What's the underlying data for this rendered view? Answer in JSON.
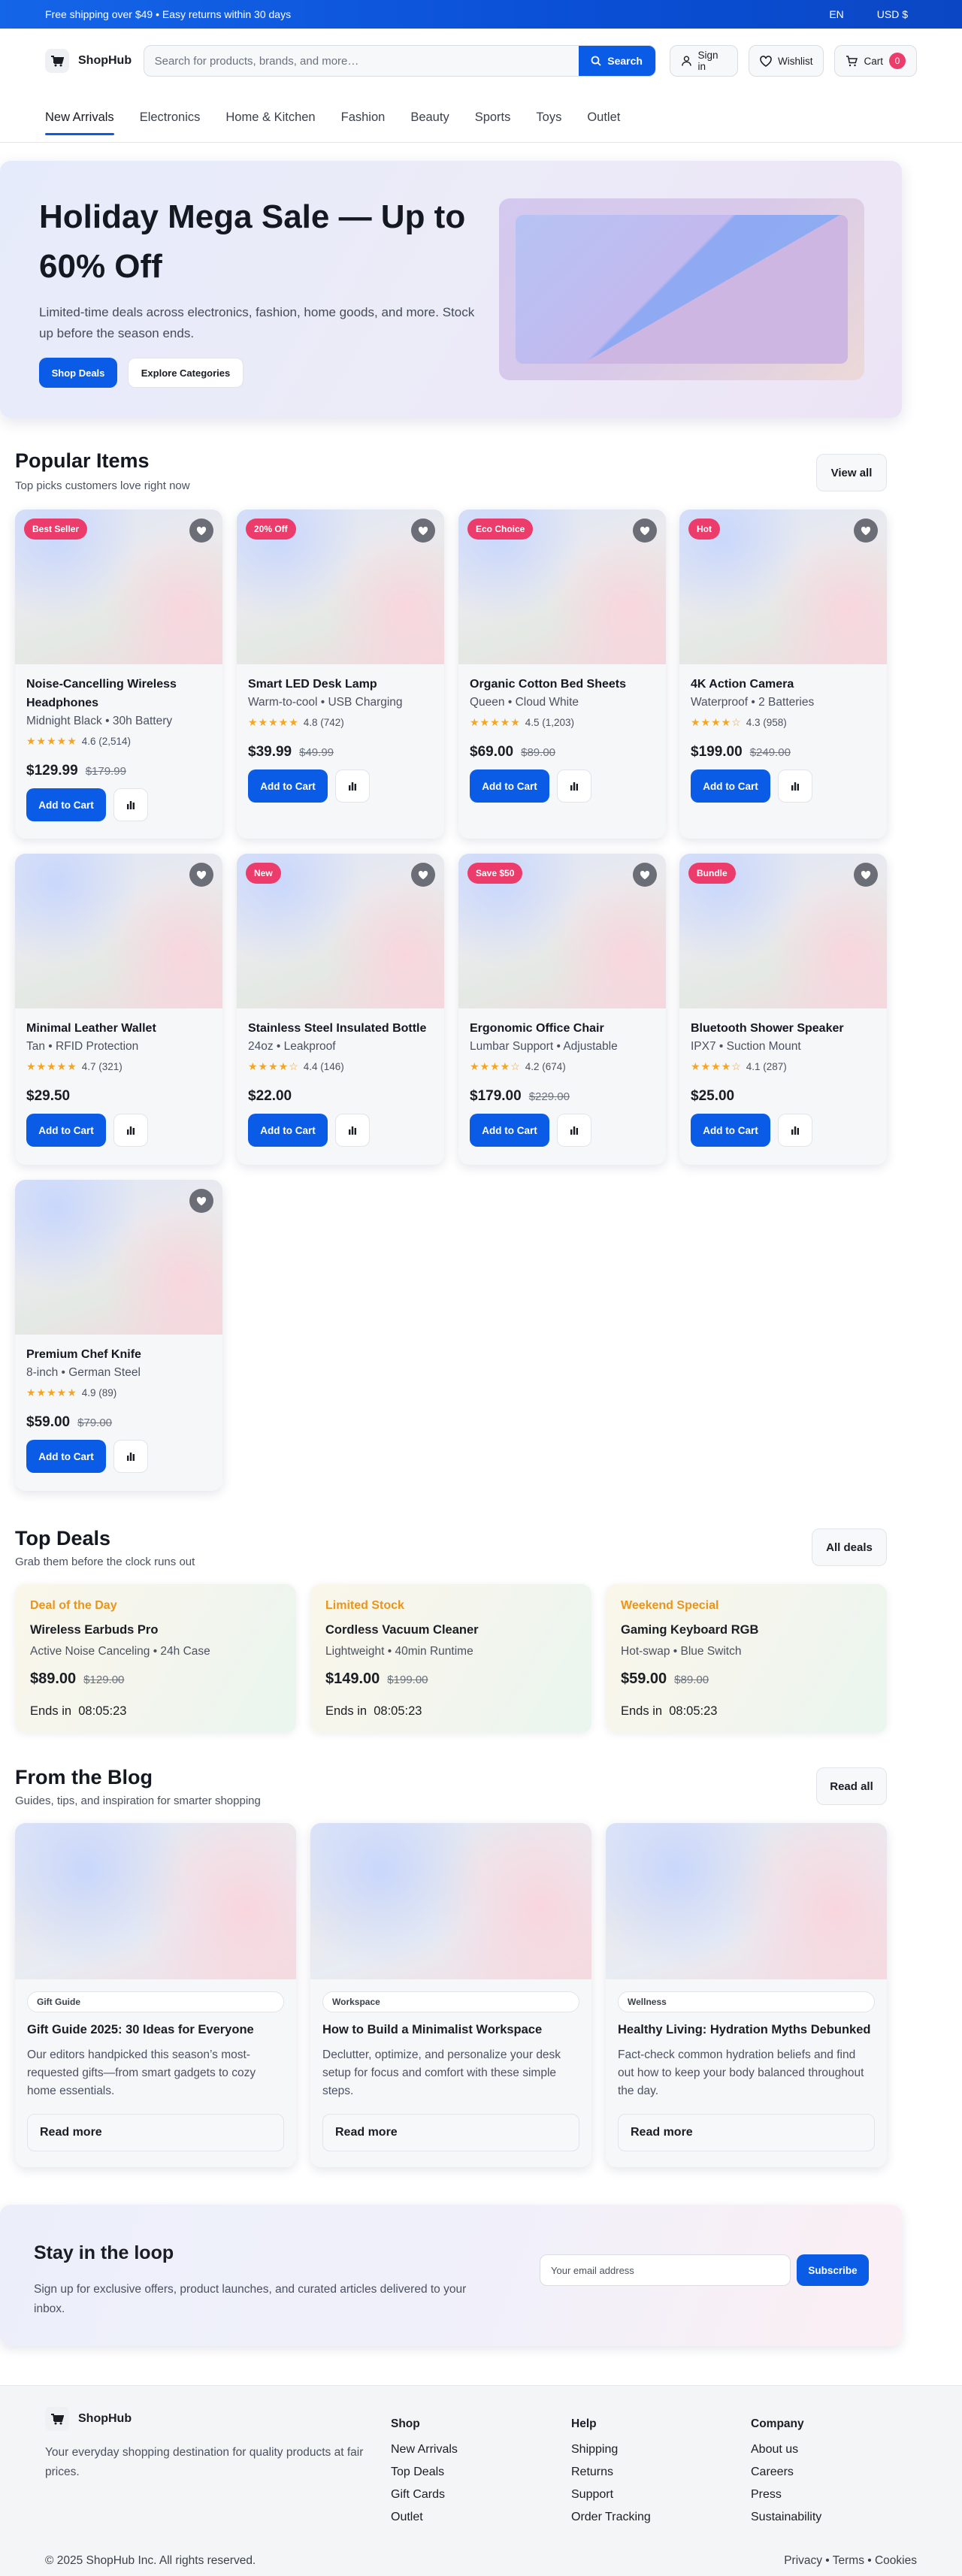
{
  "topbar": {
    "promo": "Free shipping over $49 • Easy returns within 30 days",
    "language": "EN",
    "currency": "USD $"
  },
  "header": {
    "logo": "ShopHub",
    "search_placeholder": "Search for products, brands, and more…",
    "search_button": "Search",
    "sign_in": "Sign in",
    "wishlist": "Wishlist",
    "cart": "Cart",
    "cart_count": "0"
  },
  "nav": [
    "New Arrivals",
    "Electronics",
    "Home & Kitchen",
    "Fashion",
    "Beauty",
    "Sports",
    "Toys",
    "Outlet"
  ],
  "hero": {
    "title": "Holiday Mega Sale — Up to 60% Off",
    "subtitle": "Limited-time deals across electronics, fashion, home goods, and more. Stock up before the season ends.",
    "primary_cta": "Shop Deals",
    "secondary_cta": "Explore Categories"
  },
  "popular": {
    "title": "Popular Items",
    "subtitle": "Top picks customers love right now",
    "view_all": "View all",
    "add_to_cart": "Add to Cart",
    "products": [
      {
        "badge": "Best Seller",
        "name": "Noise-Cancelling Wireless Headphones",
        "spec": "Midnight Black • 30h Battery",
        "stars": 4.6,
        "rating": "4.6 (2,514)",
        "price": "$129.99",
        "old_price": "$179.99"
      },
      {
        "badge": "20% Off",
        "name": "Smart LED Desk Lamp",
        "spec": "Warm-to-cool • USB Charging",
        "stars": 4.8,
        "rating": "4.8 (742)",
        "price": "$39.99",
        "old_price": "$49.99"
      },
      {
        "badge": "Eco Choice",
        "name": "Organic Cotton Bed Sheets",
        "spec": "Queen • Cloud White",
        "stars": 4.5,
        "rating": "4.5 (1,203)",
        "price": "$69.00",
        "old_price": "$89.00"
      },
      {
        "badge": "Hot",
        "name": "4K Action Camera",
        "spec": "Waterproof • 2 Batteries",
        "stars": 4.3,
        "rating": "4.3 (958)",
        "price": "$199.00",
        "old_price": "$249.00"
      },
      {
        "badge": "",
        "name": "Minimal Leather Wallet",
        "spec": "Tan • RFID Protection",
        "stars": 4.7,
        "rating": "4.7 (321)",
        "price": "$29.50",
        "old_price": ""
      },
      {
        "badge": "New",
        "name": "Stainless Steel Insulated Bottle",
        "spec": "24oz • Leakproof",
        "stars": 4.4,
        "rating": "4.4 (146)",
        "price": "$22.00",
        "old_price": ""
      },
      {
        "badge": "Save $50",
        "name": "Ergonomic Office Chair",
        "spec": "Lumbar Support • Adjustable",
        "stars": 4.2,
        "rating": "4.2 (674)",
        "price": "$179.00",
        "old_price": "$229.00"
      },
      {
        "badge": "Bundle",
        "name": "Bluetooth Shower Speaker",
        "spec": "IPX7 • Suction Mount",
        "stars": 4.1,
        "rating": "4.1 (287)",
        "price": "$25.00",
        "old_price": ""
      },
      {
        "badge": "",
        "name": "Premium Chef Knife",
        "spec": "8-inch • German Steel",
        "stars": 4.9,
        "rating": "4.9 (89)",
        "price": "$59.00",
        "old_price": "$79.00"
      }
    ]
  },
  "deals": {
    "title": "Top Deals",
    "subtitle": "Grab them before the clock runs out",
    "view_all": "All deals",
    "items": [
      {
        "tag": "Deal of the Day",
        "name": "Wireless Earbuds Pro",
        "spec": "Active Noise Canceling • 24h Case",
        "price": "$89.00",
        "old_price": "$129.00",
        "ends_label": "Ends in",
        "timer": "08:05:23"
      },
      {
        "tag": "Limited Stock",
        "name": "Cordless Vacuum Cleaner",
        "spec": "Lightweight • 40min Runtime",
        "price": "$149.00",
        "old_price": "$199.00",
        "ends_label": "Ends in",
        "timer": "08:05:23"
      },
      {
        "tag": "Weekend Special",
        "name": "Gaming Keyboard RGB",
        "spec": "Hot-swap • Blue Switch",
        "price": "$59.00",
        "old_price": "$89.00",
        "ends_label": "Ends in",
        "timer": "08:05:23"
      }
    ]
  },
  "blog": {
    "title": "From the Blog",
    "subtitle": "Guides, tips, and inspiration for smarter shopping",
    "view_all": "Read all",
    "read_more": "Read more",
    "posts": [
      {
        "category": "Gift Guide",
        "title": "Gift Guide 2025: 30 Ideas for Everyone",
        "excerpt": "Our editors handpicked this season’s most-requested gifts—from smart gadgets to cozy home essentials."
      },
      {
        "category": "Workspace",
        "title": "How to Build a Minimalist Workspace",
        "excerpt": "Declutter, optimize, and personalize your desk setup for focus and comfort with these simple steps."
      },
      {
        "category": "Wellness",
        "title": "Healthy Living: Hydration Myths Debunked",
        "excerpt": "Fact-check common hydration beliefs and find out how to keep your body balanced throughout the day."
      }
    ]
  },
  "newsletter": {
    "title": "Stay in the loop",
    "text": "Sign up for exclusive offers, product launches, and curated articles delivered to your inbox.",
    "placeholder": "Your email address",
    "button": "Subscribe"
  },
  "footer": {
    "logo": "ShopHub",
    "description": "Your everyday shopping destination for quality products at fair prices.",
    "columns": [
      {
        "title": "Shop",
        "links": [
          "New Arrivals",
          "Top Deals",
          "Gift Cards",
          "Outlet"
        ]
      },
      {
        "title": "Help",
        "links": [
          "Shipping",
          "Returns",
          "Support",
          "Order Tracking"
        ]
      },
      {
        "title": "Company",
        "links": [
          "About us",
          "Careers",
          "Press",
          "Sustainability"
        ]
      }
    ],
    "copyright": "© 2025 ShopHub Inc. All rights reserved.",
    "legal": "Privacy • Terms • Cookies"
  },
  "colors": {
    "accent": "#0a5ce6",
    "badge": "#ec3c6c",
    "star": "#f5a524",
    "deal_tag": "#e8951a"
  }
}
